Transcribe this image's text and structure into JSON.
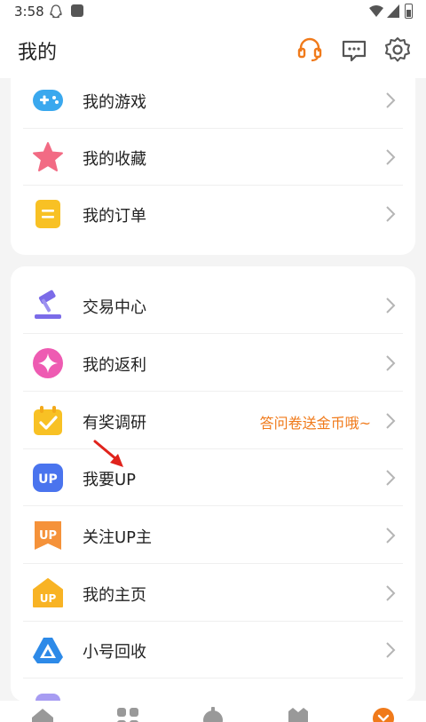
{
  "status_bar": {
    "time": "3:58",
    "icons": [
      "qq-icon",
      "app-notification-icon",
      "wifi-icon",
      "signal-icon",
      "battery-icon"
    ]
  },
  "header": {
    "title": "我的",
    "actions": [
      {
        "name": "customer-service-icon",
        "color": "#f07a1a"
      },
      {
        "name": "message-icon",
        "color": "#555555"
      },
      {
        "name": "settings-icon",
        "color": "#555555"
      }
    ]
  },
  "section1": {
    "items": [
      {
        "label": "我的游戏",
        "icon": "gamepad-icon"
      },
      {
        "label": "我的收藏",
        "icon": "star-icon"
      },
      {
        "label": "我的订单",
        "icon": "order-icon"
      }
    ]
  },
  "section2": {
    "items": [
      {
        "label": "交易中心",
        "icon": "gavel-icon"
      },
      {
        "label": "我的返利",
        "icon": "rebate-icon"
      },
      {
        "label": "有奖调研",
        "icon": "survey-icon",
        "hint": "答问卷送金币哦~"
      },
      {
        "label": "我要UP",
        "icon": "up-icon"
      },
      {
        "label": "关注UP主",
        "icon": "follow-up-icon"
      },
      {
        "label": "我的主页",
        "icon": "homepage-icon"
      },
      {
        "label": "小号回收",
        "icon": "recycle-icon"
      }
    ]
  },
  "annotation": {
    "icon": "red-arrow-icon",
    "color": "#e0231c"
  },
  "bottom_nav": {
    "tabs": [
      "home-icon",
      "category-icon",
      "trade-icon",
      "community-icon",
      "mine-icon"
    ],
    "active_color": "#f07a1a"
  },
  "colors": {
    "accent": "#f07a1a",
    "background": "#f4f4f4",
    "text": "#222222"
  }
}
